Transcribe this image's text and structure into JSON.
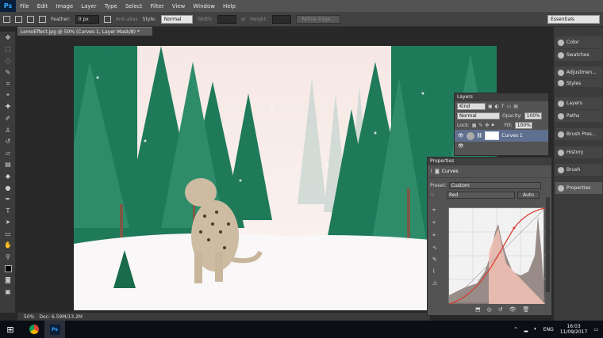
{
  "menu": {
    "logo": "Ps",
    "items": [
      "File",
      "Edit",
      "Image",
      "Layer",
      "Type",
      "Select",
      "Filter",
      "View",
      "Window",
      "Help"
    ]
  },
  "options": {
    "feather_label": "Feather:",
    "feather_value": "0 px",
    "antialias_label": "Anti-alias",
    "style_label": "Style:",
    "style_value": "Normal",
    "width_label": "Width:",
    "height_label": "Height:",
    "refine_edge": "Refine Edge...",
    "workspace": "Essentials"
  },
  "document": {
    "tab_title": "LomoEffect.jpg @ 50% (Curves 1, Layer Mask/8) *",
    "zoom": "50%",
    "doc_size": "Doc: 6.59M/13.2M"
  },
  "dock": {
    "items": [
      "Color",
      "Swatches",
      "Adjustmen...",
      "Styles",
      "Layers",
      "Paths",
      "Brush Pres...",
      "History",
      "Brush",
      "Properties"
    ]
  },
  "layers_panel": {
    "title": "Layers",
    "filter": "Kind",
    "blend": "Normal",
    "opacity_label": "Opacity:",
    "opacity": "100%",
    "lock_label": "Lock:",
    "fill_label": "Fill:",
    "fill": "100%",
    "layer_name": "Curves 1"
  },
  "properties_panel": {
    "title": "Properties",
    "type": "Curves",
    "preset_label": "Preset:",
    "preset": "Custom",
    "channel": "Red",
    "auto": "Auto"
  },
  "taskbar": {
    "language": "ENG",
    "time": "16:03",
    "date": "11/09/2017"
  },
  "colors": {
    "accent": "#31a8ff",
    "curve_red": "#d43a2a",
    "selected_layer": "#5e6f8f"
  }
}
